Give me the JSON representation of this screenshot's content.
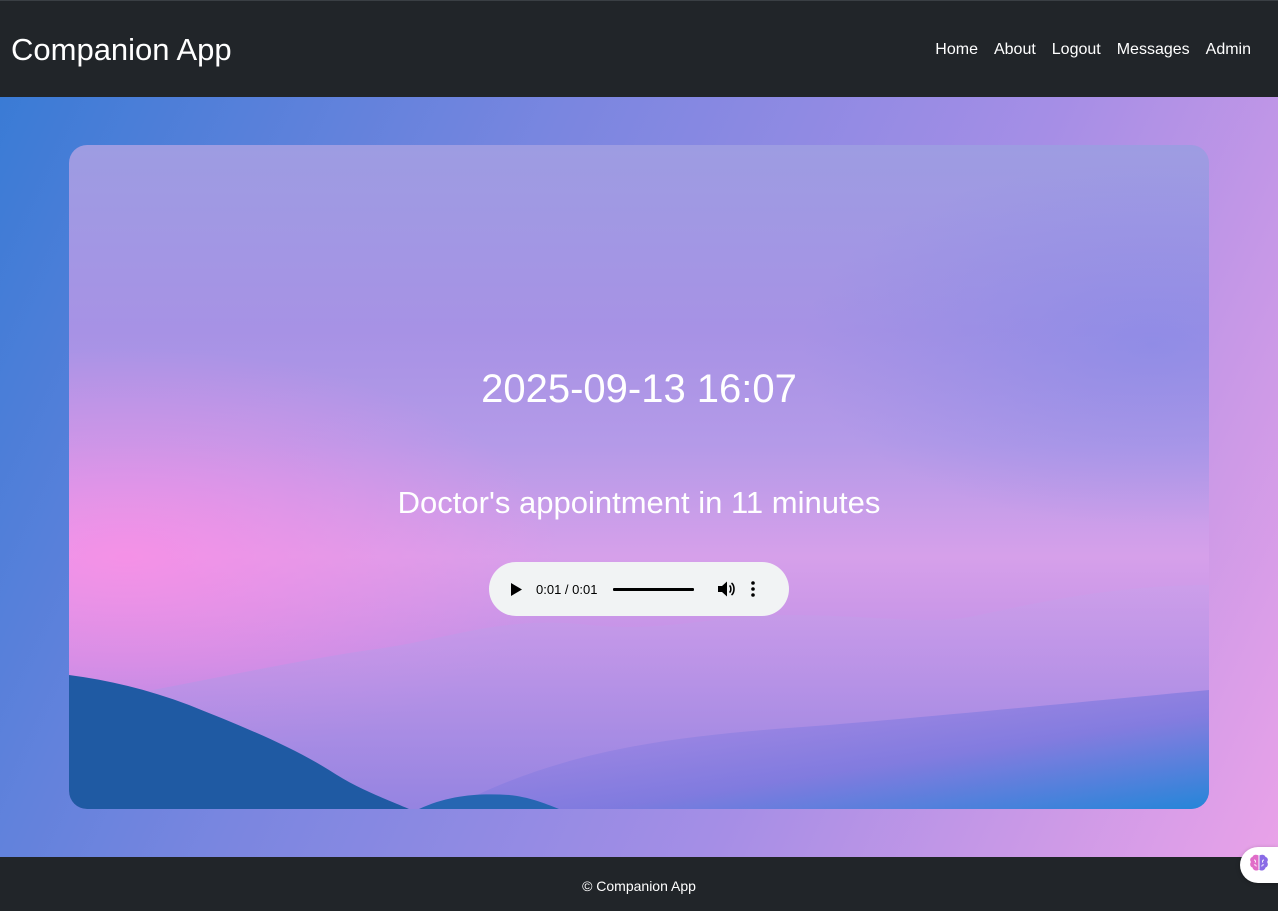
{
  "header": {
    "brand": "Companion App",
    "nav": [
      "Home",
      "About",
      "Logout",
      "Messages",
      "Admin"
    ]
  },
  "main": {
    "datetime": "2025-09-13 16:07",
    "reminder": "Doctor's appointment in 11 minutes",
    "audio_player": {
      "time": "0:01 / 0:01",
      "progress": 1.0
    }
  },
  "footer": {
    "text": "© Companion App"
  },
  "colors": {
    "navbar_bg": "#212529",
    "player_bg": "#f1f3f4",
    "text": "#ffffff"
  },
  "icons": [
    "play-icon",
    "volume-icon",
    "more-options-icon",
    "brain-icon"
  ]
}
